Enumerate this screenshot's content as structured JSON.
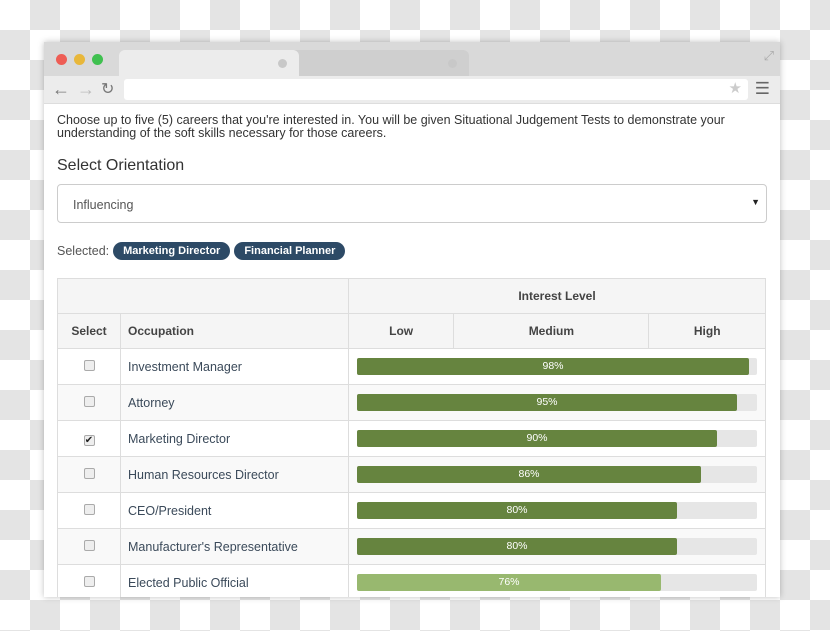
{
  "intro": "Choose up to five (5) careers that you're interested in. You will be given Situational Judgement Tests to demonstrate your understanding of the soft skills necessary for those careers.",
  "orientation_title": "Select Orientation",
  "orientation_value": "Influencing",
  "selected_label": "Selected:",
  "selected": [
    "Marketing Director",
    "Financial Planner"
  ],
  "table": {
    "interest_header": "Interest Level",
    "select_header": "Select",
    "occupation_header": "Occupation",
    "levels": [
      "Low",
      "Medium",
      "High"
    ],
    "rows": [
      {
        "occupation": "Investment Manager",
        "percent": 98,
        "label": "98%",
        "checked": false,
        "color": "#66843f"
      },
      {
        "occupation": "Attorney",
        "percent": 95,
        "label": "95%",
        "checked": false,
        "color": "#66843f"
      },
      {
        "occupation": "Marketing Director",
        "percent": 90,
        "label": "90%",
        "checked": true,
        "color": "#66843f"
      },
      {
        "occupation": "Human Resources Director",
        "percent": 86,
        "label": "86%",
        "checked": false,
        "color": "#66843f"
      },
      {
        "occupation": "CEO/President",
        "percent": 80,
        "label": "80%",
        "checked": false,
        "color": "#66843f"
      },
      {
        "occupation": "Manufacturer's Representative",
        "percent": 80,
        "label": "80%",
        "checked": false,
        "color": "#66843f"
      },
      {
        "occupation": "Elected Public Official",
        "percent": 76,
        "label": "76%",
        "checked": false,
        "color": "#98b86f"
      }
    ]
  }
}
